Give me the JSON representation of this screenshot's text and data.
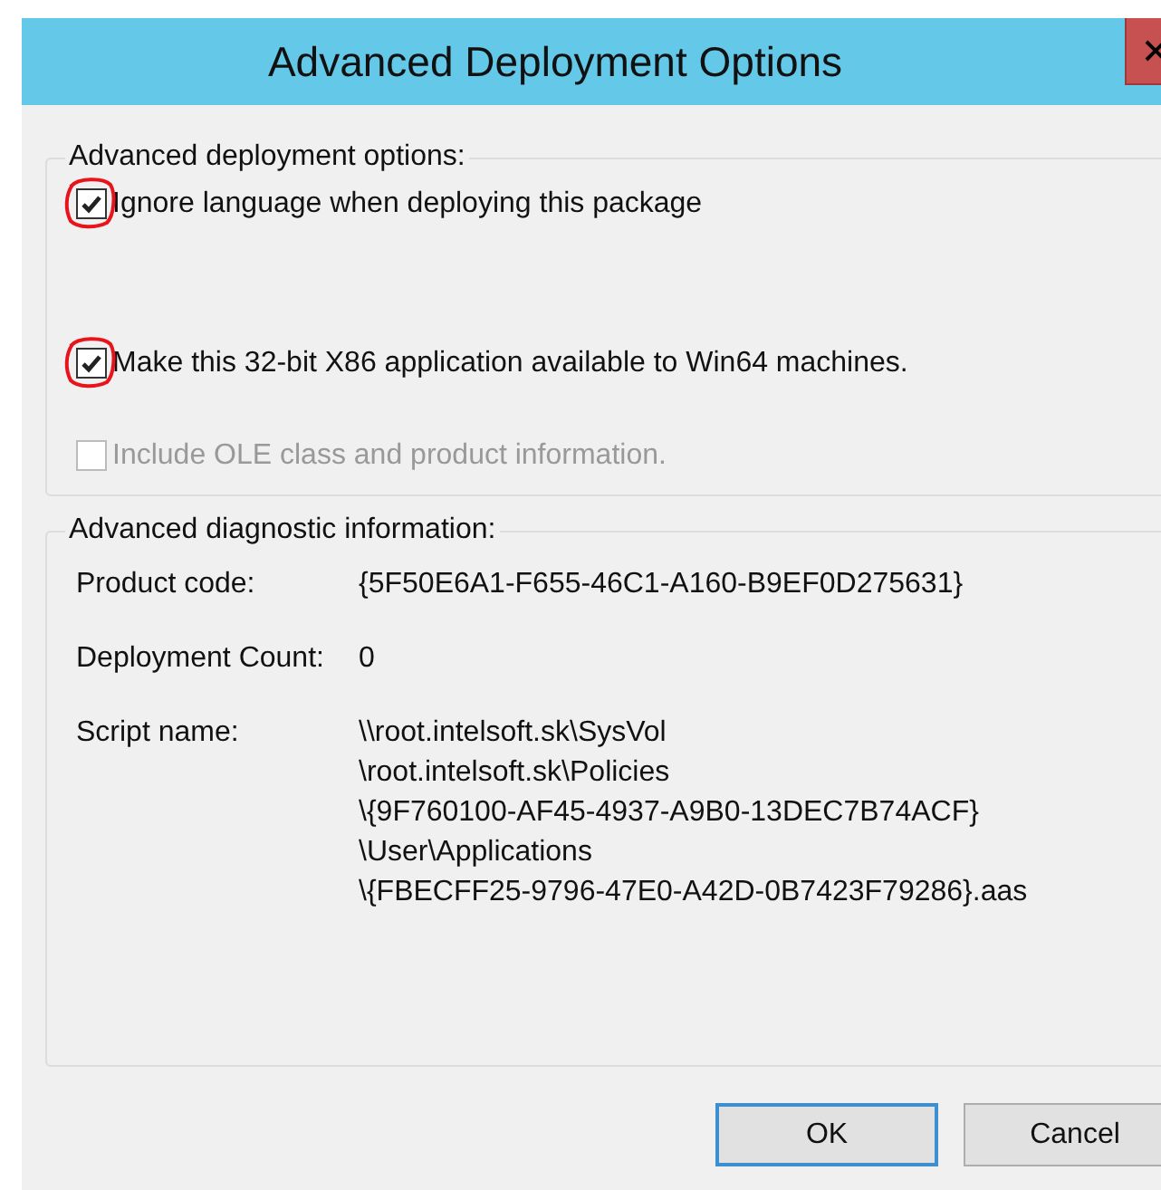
{
  "window": {
    "title": "Advanced Deployment Options"
  },
  "deployment_options": {
    "heading": "Advanced deployment options:",
    "options": [
      {
        "label": "Ignore language when deploying this package",
        "checked": true,
        "disabled": false,
        "circled": true
      },
      {
        "label": "Make this 32-bit X86 application available to Win64 machines.",
        "checked": true,
        "disabled": false,
        "circled": true
      },
      {
        "label": "Include OLE class and product information.",
        "checked": false,
        "disabled": true,
        "circled": false
      }
    ]
  },
  "diagnostics": {
    "heading": "Advanced diagnostic information:",
    "rows": [
      {
        "label": "Product code:",
        "value_lines": [
          "{5F50E6A1-F655-46C1-A160-B9EF0D275631}"
        ]
      },
      {
        "label": "Deployment Count:",
        "value_lines": [
          "0"
        ]
      },
      {
        "label": "Script name:",
        "value_lines": [
          "\\\\root.intelsoft.sk\\SysVol",
          "\\root.intelsoft.sk\\Policies",
          "\\{9F760100-AF45-4937-A9B0-13DEC7B74ACF}",
          "\\User\\Applications",
          "\\{FBECFF25-9796-47E0-A42D-0B7423F79286}.aas"
        ]
      }
    ]
  },
  "buttons": [
    {
      "label": "OK",
      "default": true
    },
    {
      "label": "Cancel",
      "default": false
    }
  ]
}
